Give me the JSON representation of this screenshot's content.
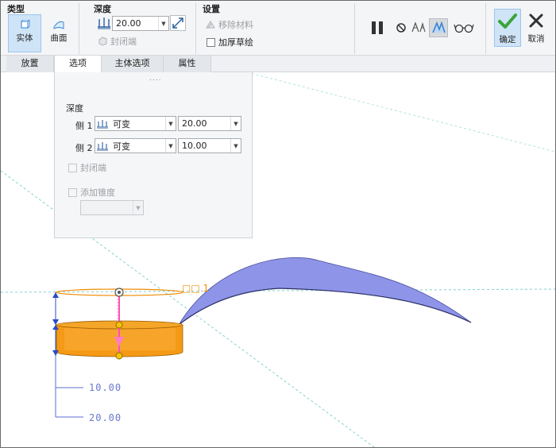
{
  "ribbon": {
    "type_group": {
      "title": "类型",
      "solid_label": "实体",
      "surface_label": "曲面"
    },
    "depth_group": {
      "title": "深度",
      "depth_value": "20.00",
      "capped_ends_label": "封闭端"
    },
    "settings_group": {
      "title": "设置",
      "remove_material_label": "移除材料",
      "thicken_sketch_label": "加厚草绘"
    },
    "confirm_label": "确定",
    "cancel_label": "取消"
  },
  "tabs": [
    {
      "label": "放置"
    },
    {
      "label": "选项"
    },
    {
      "label": "主体选项"
    },
    {
      "label": "属性"
    }
  ],
  "options_panel": {
    "grip": "....",
    "depth_heading": "深度",
    "side1": {
      "label": "侧 1",
      "type": "可变",
      "value": "20.00"
    },
    "side2": {
      "label": "侧 2",
      "type": "可变",
      "value": "10.00"
    },
    "capped_ends_label": "封闭端",
    "add_taper_label": "添加锥度",
    "taper_value": ""
  },
  "viewport": {
    "dim_label_top": "□□ 1",
    "dim_10": "10.00",
    "dim_20": "20.00"
  },
  "colors": {
    "accent": "#2f7fd1",
    "active_bg": "#cfe4f7",
    "solid_orange": "#f59a16",
    "surface_blue": "#8e95e8",
    "handle_pink": "#ff4fb4",
    "confirm_green": "#3aa53a"
  }
}
